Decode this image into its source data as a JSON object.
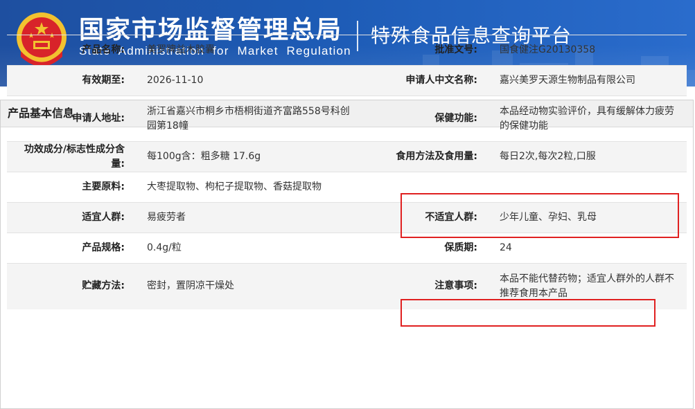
{
  "header": {
    "org_cn": "国家市场监督管理总局",
    "org_en": "State Administration  for  Market Regulation",
    "platform": "特殊食品信息查询平台",
    "brand_color": "#1e4fa0",
    "emblem_icon": "national-emblem-icon"
  },
  "panel": {
    "title": "产品基本信息"
  },
  "rows": [
    {
      "l1": "产品名称:",
      "v1": "美罗牌益木胶囊",
      "l2": "批准文号:",
      "v2": "国食健注G20130358"
    },
    {
      "l1": "有效期至:",
      "v1": "2026-11-10",
      "l2": "申请人中文名称:",
      "v2": "嘉兴美罗天源生物制品有限公司"
    },
    {
      "l1": "申请人地址:",
      "v1": "浙江省嘉兴市桐乡市梧桐街道齐富路558号科创园第18幢",
      "l2": "保健功能:",
      "v2": "本品经动物实验评价，具有缓解体力疲劳的保健功能"
    },
    {
      "l1": "功效成分/标志性成分含量:",
      "v1": "每100g含：粗多糖 17.6g",
      "l2": "食用方法及食用量:",
      "v2": "每日2次,每次2粒,口服"
    },
    {
      "l1": "主要原料:",
      "v1": "大枣提取物、枸杞子提取物、香菇提取物",
      "l2": "",
      "v2": ""
    },
    {
      "l1": "适宜人群:",
      "v1": "易疲劳者",
      "l2": "不适宜人群:",
      "v2": "少年儿童、孕妇、乳母"
    },
    {
      "l1": "产品规格:",
      "v1": "0.4g/粒",
      "l2": "保质期:",
      "v2": "24"
    },
    {
      "l1": "贮藏方法:",
      "v1": "密封，置阴凉干燥处",
      "l2": "注意事项:",
      "v2": "本品不能代替药物；适宜人群外的人群不推荐食用本产品"
    }
  ],
  "highlight_color": "#e02020"
}
